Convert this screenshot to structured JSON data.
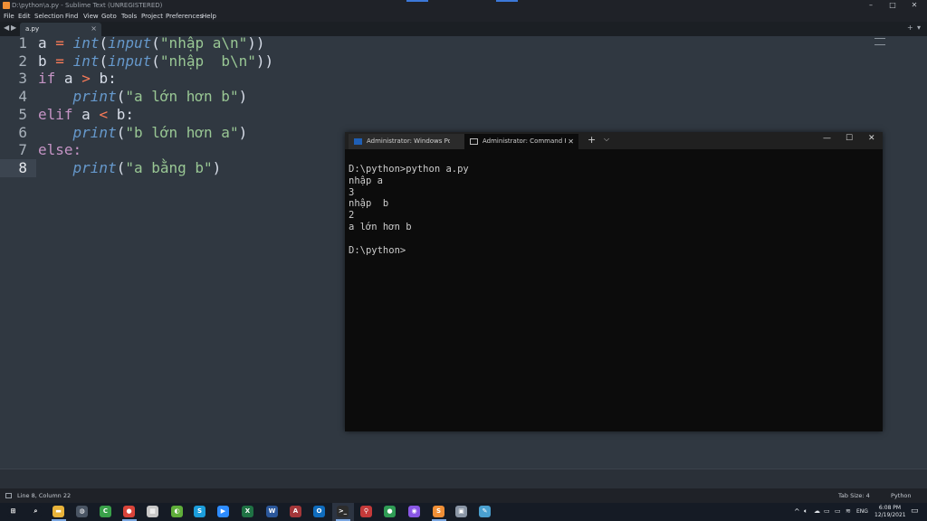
{
  "window": {
    "title": "D:\\python\\a.py - Sublime Text (UNREGISTERED)"
  },
  "window_controls": {
    "minimize": "–",
    "maximize": "□",
    "close": "✕"
  },
  "menu": [
    "File",
    "Edit",
    "Selection",
    "Find",
    "View",
    "Goto",
    "Tools",
    "Project",
    "Preferences",
    "Help"
  ],
  "tabs": {
    "nav_left": "◀",
    "nav_right": "▶",
    "active_file": "a.py",
    "close": "×",
    "add": "+",
    "list": "▾"
  },
  "editor": {
    "line_numbers": [
      "1",
      "2",
      "3",
      "4",
      "5",
      "6",
      "7",
      "8"
    ],
    "current_line": 8,
    "code": {
      "l1": {
        "var": "a",
        "eq": "=",
        "fn1": "int",
        "p1": "(",
        "fn2": "input",
        "p2": "(",
        "str": "\"nhập a\\n\"",
        "p3": "))"
      },
      "l2": {
        "var": "b",
        "eq": "=",
        "fn1": "int",
        "p1": "(",
        "fn2": "input",
        "p2": "(",
        "str": "\"nhập  b\\n\"",
        "p3": "))"
      },
      "l3": {
        "kw": "if",
        "a": "a",
        "op": ">",
        "b": "b:"
      },
      "l4": {
        "fn": "print",
        "p1": "(",
        "str": "\"a lớn hơn b\"",
        "p2": ")"
      },
      "l5": {
        "kw": "elif",
        "a": "a",
        "op": "<",
        "b": "b:"
      },
      "l6": {
        "fn": "print",
        "p1": "(",
        "str": "\"b lớn hơn a\"",
        "p2": ")"
      },
      "l7": {
        "kw": "else:"
      },
      "l8": {
        "fn": "print",
        "p1": "(",
        "str": "\"a bằng b\"",
        "p2": ")"
      }
    }
  },
  "terminal": {
    "tabs": [
      {
        "label": "Administrator: Windows PowerS",
        "icon": "powershell-icon"
      },
      {
        "label": "Administrator: Command Promp",
        "icon": "cmd-icon",
        "close": "✕"
      }
    ],
    "new_tab": "+",
    "dropdown": "⌵",
    "controls": {
      "minimize": "—",
      "maximize": "☐",
      "close": "✕"
    },
    "lines": [
      "D:\\python>python a.py",
      "nhập a",
      "3",
      "nhập  b",
      "2",
      "a lớn hơn b",
      "",
      "D:\\python>"
    ]
  },
  "status": {
    "position": "Line 8, Column 22",
    "tab_size": "Tab Size: 4",
    "syntax": "Python"
  },
  "taskbar": {
    "apps": [
      {
        "name": "start-icon",
        "glyph": "⊞",
        "color": "#151b25"
      },
      {
        "name": "search-icon",
        "glyph": "⌕",
        "color": "#151b25"
      },
      {
        "name": "file-explorer-icon",
        "glyph": "▬",
        "color": "#e8b33a"
      },
      {
        "name": "app-circle-icon",
        "glyph": "◍",
        "color": "#4a5564"
      },
      {
        "name": "camtasia-icon",
        "glyph": "C",
        "color": "#3aa14a"
      },
      {
        "name": "chrome-icon",
        "glyph": "●",
        "color": "#d9443a"
      },
      {
        "name": "app-grid-icon",
        "glyph": "▦",
        "color": "#c8c8c8"
      },
      {
        "name": "app-green-icon",
        "glyph": "◐",
        "color": "#5fae3a"
      },
      {
        "name": "skype-icon",
        "glyph": "S",
        "color": "#1b9ddb"
      },
      {
        "name": "zoom-icon",
        "glyph": "▶",
        "color": "#2d8cff"
      },
      {
        "name": "excel-icon",
        "glyph": "X",
        "color": "#1f7244"
      },
      {
        "name": "word-icon",
        "glyph": "W",
        "color": "#2b579a"
      },
      {
        "name": "access-icon",
        "glyph": "A",
        "color": "#a4373a"
      },
      {
        "name": "outlook-icon",
        "glyph": "O",
        "color": "#0f6cbd"
      },
      {
        "name": "terminal-icon",
        "glyph": ">_",
        "color": "#2c2c2c"
      },
      {
        "name": "app-pin-icon",
        "glyph": "⚲",
        "color": "#c43a3a"
      },
      {
        "name": "chrome-alt-icon",
        "glyph": "●",
        "color": "#2f9c55"
      },
      {
        "name": "github-icon",
        "glyph": "◉",
        "color": "#8957e5"
      },
      {
        "name": "sublime-icon",
        "glyph": "S",
        "color": "#f08f36"
      },
      {
        "name": "app-box-icon",
        "glyph": "▣",
        "color": "#8a96a6"
      },
      {
        "name": "app-pen-icon",
        "glyph": "✎",
        "color": "#4aa0d0"
      }
    ],
    "tray": {
      "lang": "ENG",
      "time": "6:08 PM",
      "date": "12/19/2021"
    }
  }
}
